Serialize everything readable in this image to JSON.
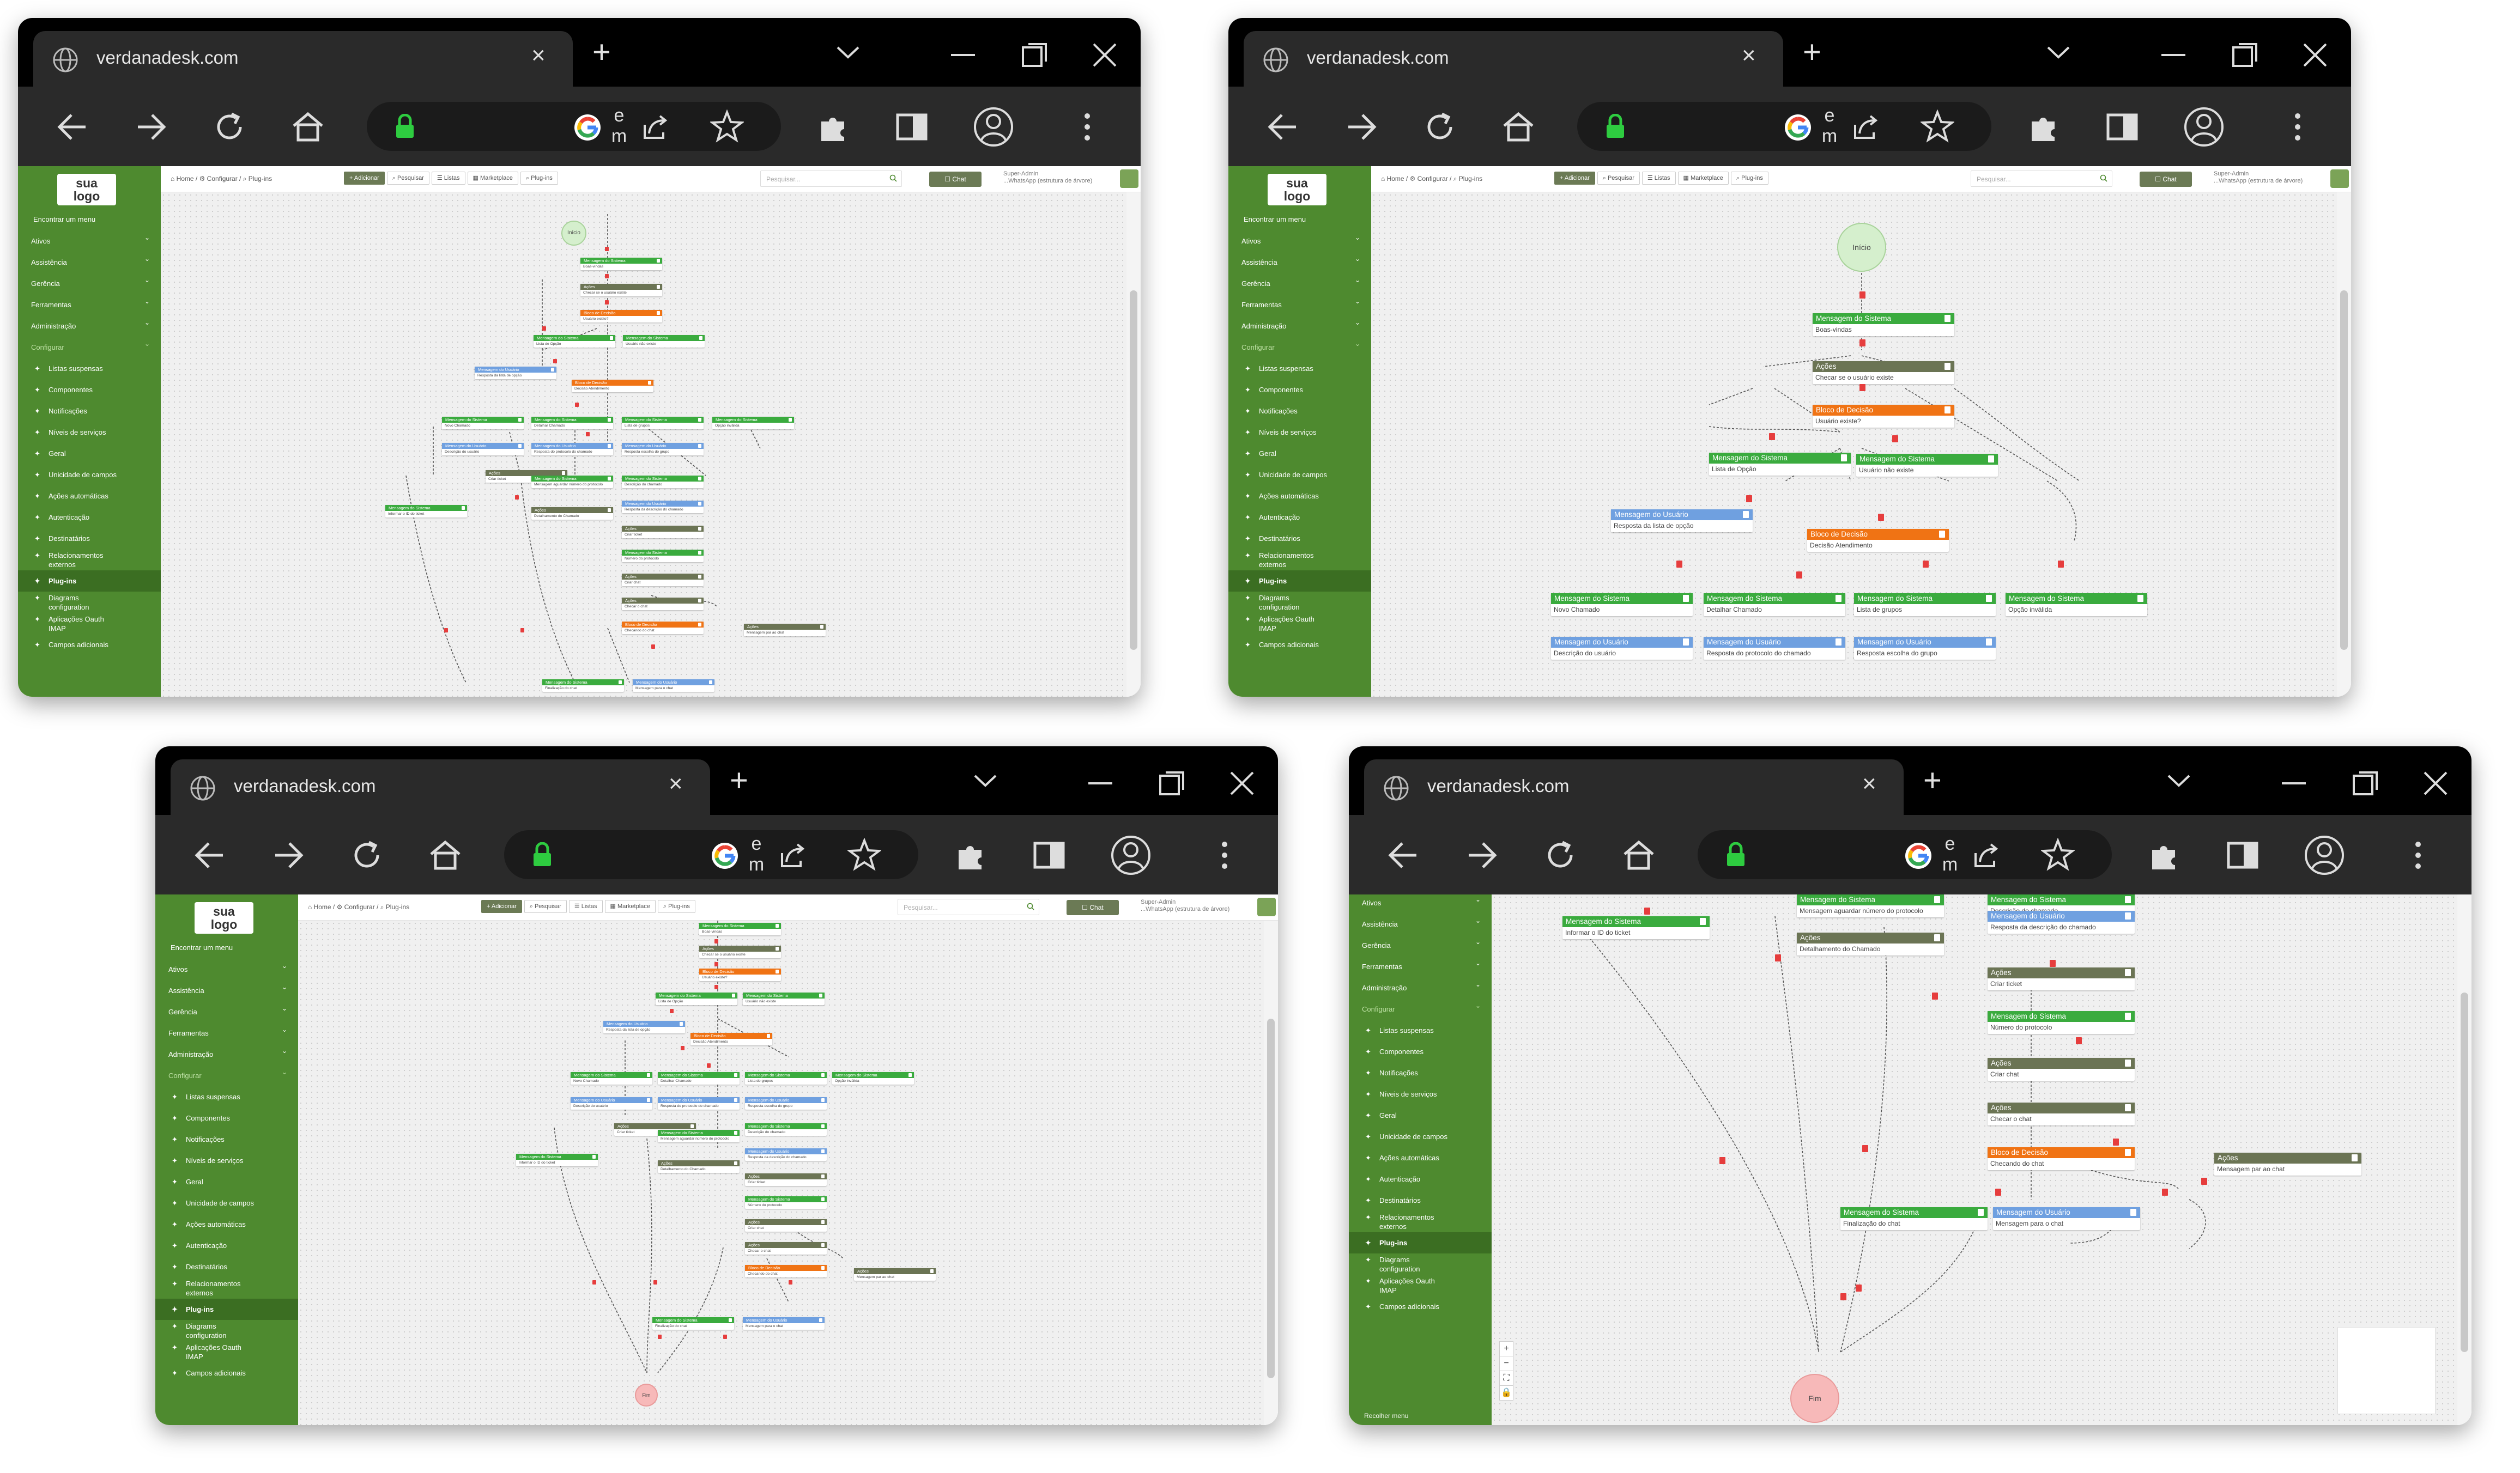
{
  "browser": {
    "tab_title": "verdanadesk.com",
    "new_tab": "+",
    "tab_close": "×",
    "address_extra": "e\nm"
  },
  "sidebar": {
    "logo": "sua\nlogo",
    "find_menu": "Encontrar um menu",
    "top_items": [
      "Ativos",
      "Assistência",
      "Gerência",
      "Ferramentas",
      "Administração",
      "Configurar"
    ],
    "sub_items": [
      "Listas suspensas",
      "Componentes",
      "Notificações",
      "Níveis de serviços",
      "Geral",
      "Unicidade de campos",
      "Ações automáticas",
      "Autenticação",
      "Destinatários",
      "Relacionamentos\nexternos",
      "Plug-ins",
      "Diagrams\nconfiguration",
      "Aplicações Oauth\nIMAP",
      "Campos adicionais"
    ],
    "selected": "Plug-ins",
    "collapse": "Recolher menu"
  },
  "topbar": {
    "breadcrumb": "⌂ Home  /  ⚙ Configurar  /  ⌕ Plug-ins",
    "buttons": [
      "+ Adicionar",
      "⌕ Pesquisar",
      "☰ Listas",
      "▦ Marketplace",
      "⌕ Plug-ins"
    ],
    "search_placeholder": "Pesquisar...",
    "chat": "☐ Chat",
    "user_role": "Super-Admin",
    "user_entity": "...WhatsApp (estrutura de árvore)"
  },
  "flow": {
    "start": "Início",
    "end": "Fim",
    "labels": {
      "sysmsg": "Mensagem do Sistema",
      "usermsg": "Mensagem do Usuário",
      "actions": "Ações",
      "decision": "Bloco de Decisão"
    },
    "bodies": {
      "welcome": "Boas-vindas",
      "check_user": "Checar se o usuário existe",
      "user_exists": "Usuário existe?",
      "option_list": "Lista de Opção",
      "user_not_exist": "Usuário não existe",
      "option_answer": "Resposta da lista de opção",
      "decision_service": "Decisão Atendimento",
      "new_ticket": "Novo Chamado",
      "detail_ticket": "Detalhar Chamado",
      "group_list": "Lista de grupos",
      "invalid_option": "Opção inválida",
      "user_description": "Descrição do usuário",
      "protocol_answer": "Resposta do protocolo do chamado",
      "group_choice": "Resposta escolha do grupo",
      "inform_ticket_id": "Informar o ID do ticket",
      "wait_protocol": "Mensagem aguardar número do protocolo",
      "ticket_detail": "Detalhamento do Chamado",
      "ticket_description": "Descrição do chamado",
      "description_answer": "Resposta da descrição do chamado",
      "create_ticket": "Criar ticket",
      "protocol_number": "Número do protocolo",
      "create_chat": "Criar chat",
      "check_chat": "Checar o chat",
      "checking_chat": "Checando do chat",
      "finish_chat": "Finalização do chat",
      "msg_to_chat": "Mensagem para o chat",
      "msg_pair_chat": "Mensagem par ao chat"
    }
  },
  "colors": {
    "sidebar": "#4e8a2f",
    "system_message": "#3aab3e",
    "user_message": "#6fa0e0",
    "actions": "#6b7454",
    "decision": "#f07314",
    "chrome_dark": "#2a2a2a"
  },
  "zoom_controls": [
    "+",
    "−",
    "⛶",
    "🔒"
  ]
}
